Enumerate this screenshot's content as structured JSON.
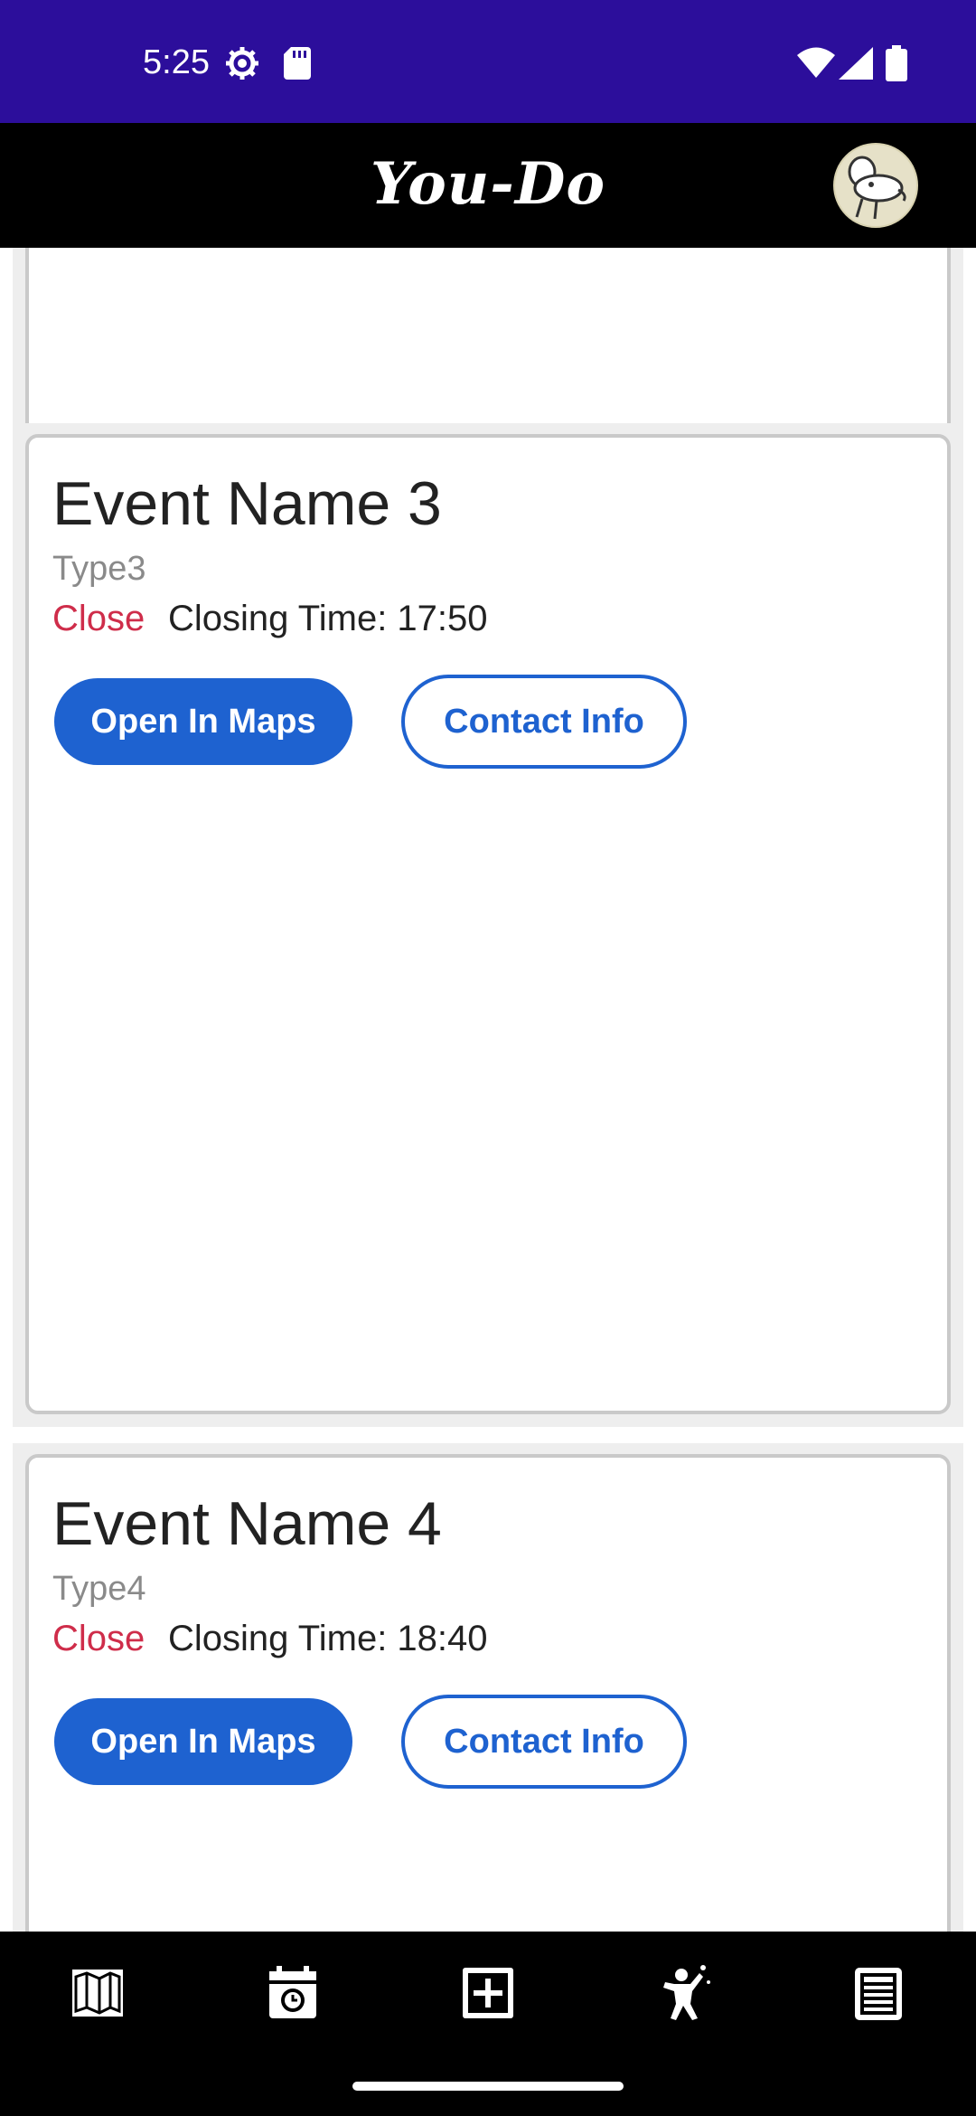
{
  "status_bar": {
    "time": "5:25",
    "icons": [
      "settings-gear-icon",
      "sd-card-icon",
      "wifi-icon",
      "cell-signal-icon",
      "battery-icon"
    ]
  },
  "app_bar": {
    "title": "You-Do",
    "avatar": "profile-avatar"
  },
  "events": [
    {
      "name": "Event Name 3",
      "type": "Type3",
      "status": "Close",
      "closing_time": "Closing Time: 17:50",
      "maps_label": "Open In Maps",
      "contact_label": "Contact Info"
    },
    {
      "name": "Event Name 4",
      "type": "Type4",
      "status": "Close",
      "closing_time": "Closing Time: 18:40",
      "maps_label": "Open In Maps",
      "contact_label": "Contact Info"
    }
  ],
  "bottom_nav": {
    "items": [
      "map-icon",
      "calendar-alarm-icon",
      "add-box-icon",
      "person-celebrate-icon",
      "notes-list-icon"
    ]
  },
  "colors": {
    "status_bar": "#2c0e9b",
    "app_bar": "#000000",
    "primary": "#1e62d0",
    "status_close": "#cf2d4a"
  }
}
